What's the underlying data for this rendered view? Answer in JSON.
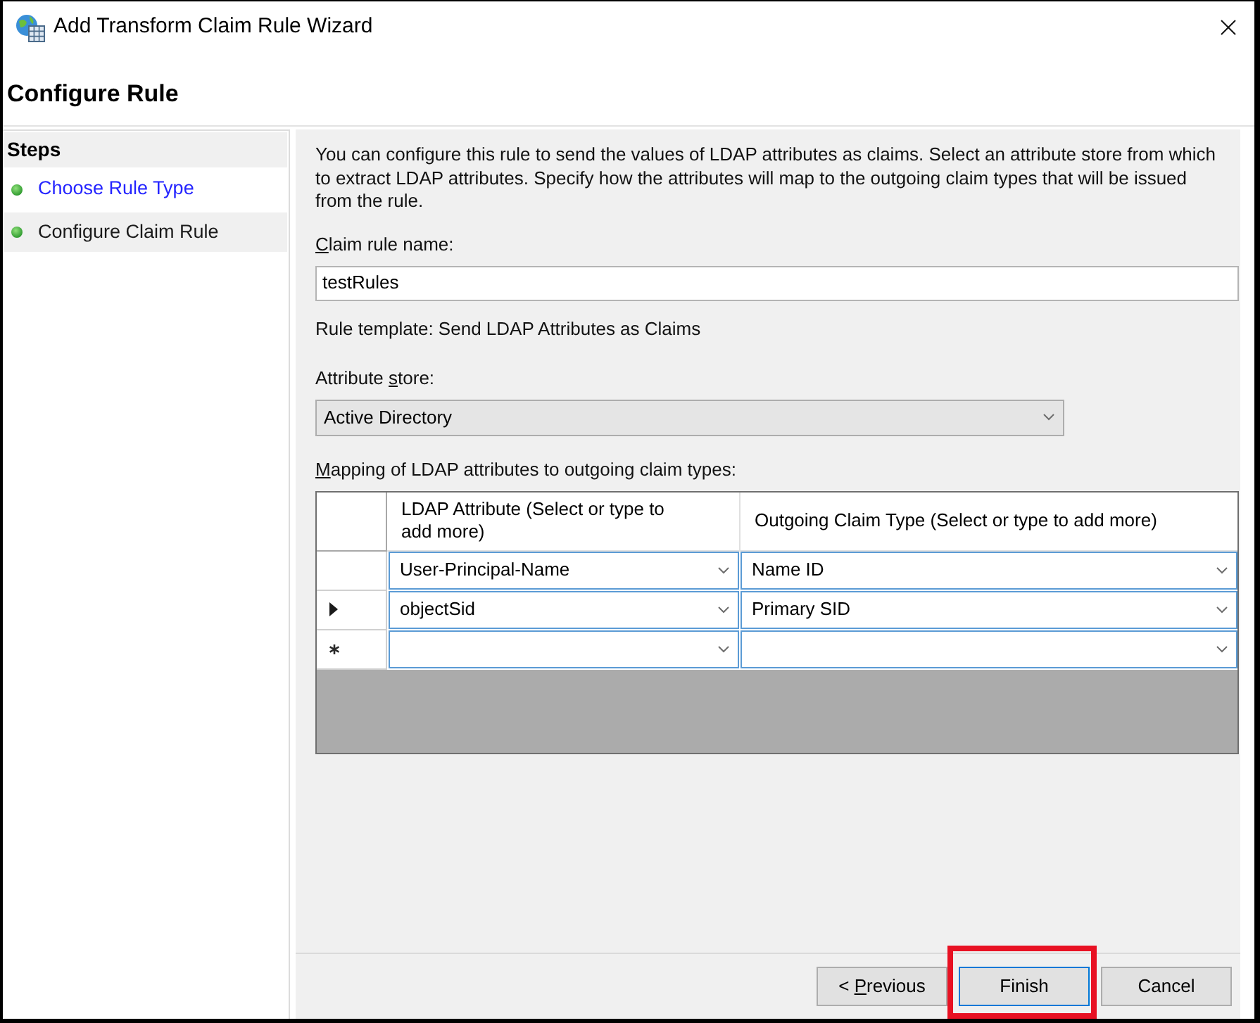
{
  "window": {
    "title": "Add Transform Claim Rule Wizard"
  },
  "page_title": "Configure Rule",
  "steps": {
    "heading": "Steps",
    "items": [
      {
        "label": "Choose Rule Type",
        "selected": false
      },
      {
        "label": "Configure Claim Rule",
        "selected": true
      }
    ]
  },
  "form": {
    "description": "You can configure this rule to send the values of LDAP attributes as claims. Select an attribute store from which to extract LDAP attributes. Specify how the attributes will map to the outgoing claim types that will be issued from the rule.",
    "claim_rule_name": {
      "label": {
        "key": "C",
        "after": "laim rule name:"
      },
      "value": "testRules"
    },
    "rule_template": "Rule template: Send LDAP Attributes as Claims",
    "attribute_store": {
      "label": {
        "before": "Attribute ",
        "key": "s",
        "after": "tore:"
      },
      "value": "Active Directory"
    }
  },
  "mapping": {
    "label": {
      "key": "M",
      "after": "apping of LDAP attributes to outgoing claim types:"
    },
    "columns": [
      "LDAP Attribute (Select or type to add more)",
      "Outgoing Claim Type (Select or type to add more)"
    ],
    "rows": [
      {
        "kind": "data",
        "selected": false,
        "attribute": "User-Principal-Name",
        "claim_type": "Name ID"
      },
      {
        "kind": "data",
        "selected": true,
        "attribute": "objectSid",
        "claim_type": "Primary SID"
      },
      {
        "kind": "new",
        "selected": false
      }
    ]
  },
  "buttons": [
    {
      "label": {
        "before": "< ",
        "key": "P",
        "after": "revious"
      },
      "focused": false,
      "highlighted": false
    },
    {
      "label": {
        "before": "Finish"
      },
      "focused": true,
      "highlighted": true
    },
    {
      "label": {
        "before": "Cancel"
      },
      "focused": false,
      "highlighted": false
    }
  ]
}
